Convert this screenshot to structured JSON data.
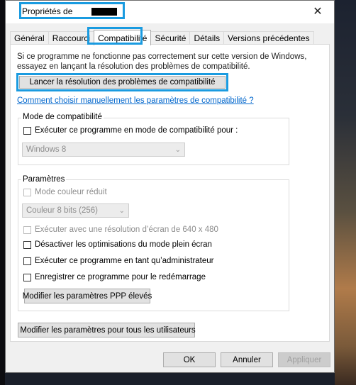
{
  "window": {
    "title": "Propriétés de",
    "close_glyph": "✕"
  },
  "tabs": [
    {
      "label": "Général"
    },
    {
      "label": "Raccourci"
    },
    {
      "label": "Compatibilité"
    },
    {
      "label": "Sécurité"
    },
    {
      "label": "Détails"
    },
    {
      "label": "Versions précédentes"
    }
  ],
  "compat": {
    "info_line1": "Si ce programme ne fonctionne pas correctement sur cette version de Windows,",
    "info_line2": "essayez en lançant la résolution des problèmes de compatibilité.",
    "troubleshoot_button": "Lancer la résolution des problèmes de compatibilité",
    "manual_link": "Comment choisir manuellement les paramètres de compatibilité ?",
    "mode_group_label": "Mode de compatibilité",
    "mode_checkbox": "Exécuter ce programme en mode de compatibilité pour :",
    "mode_select_value": "Windows 8",
    "settings_group_label": "Paramètres",
    "reduced_color": "Mode couleur réduit",
    "color_select_value": "Couleur 8 bits (256)",
    "res_640": "Exécuter avec une résolution d’écran de 640 x 480",
    "disable_fullscreen": "Désactiver les optimisations du mode plein écran",
    "run_admin": "Exécuter ce programme en tant qu’administrateur",
    "register_restart": "Enregistrer ce programme pour le redémarrage",
    "dpi_button": "Modifier les paramètres PPP élevés",
    "all_users_button": "Modifier les paramètres pour tous les utilisateurs"
  },
  "footer": {
    "ok": "OK",
    "cancel": "Annuler",
    "apply": "Appliquer"
  },
  "icons": {
    "close": "close-icon",
    "shield": "uac-shield-icon",
    "dropdown": "chevron-down-icon"
  }
}
